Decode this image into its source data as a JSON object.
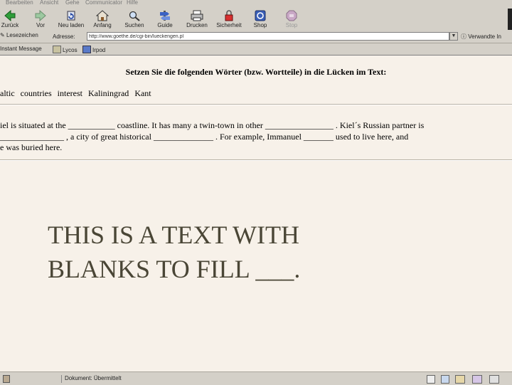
{
  "menu": [
    "Bearbeiten",
    "Ansicht",
    "Gehe",
    "Communicator",
    "Hilfe"
  ],
  "toolbar": [
    {
      "label": "Zurück",
      "icon": "back-arrow-icon",
      "enabled": true
    },
    {
      "label": "Vor",
      "icon": "forward-arrow-icon",
      "enabled": true
    },
    {
      "label": "Neu laden",
      "icon": "reload-icon",
      "enabled": true
    },
    {
      "label": "Anfang",
      "icon": "home-icon",
      "enabled": true
    },
    {
      "label": "Suchen",
      "icon": "search-icon",
      "enabled": true
    },
    {
      "label": "Guide",
      "icon": "guide-icon",
      "enabled": true
    },
    {
      "label": "Drucken",
      "icon": "print-icon",
      "enabled": true
    },
    {
      "label": "Sicherheit",
      "icon": "lock-icon",
      "enabled": true
    },
    {
      "label": "Shop",
      "icon": "shop-icon",
      "enabled": true
    },
    {
      "label": "Stop",
      "icon": "stop-icon",
      "enabled": false
    }
  ],
  "address_bar": {
    "bookmarks_label": "Lesezeichen",
    "address_label": "Adresse:",
    "url": "http://www.goethe.de/cgi-bin/lueckengen.pl",
    "related_label": "Verwandte In"
  },
  "personal_toolbar": [
    "Instant Message",
    "Lycos",
    "Irpod"
  ],
  "content": {
    "instruction": "Setzen Sie die folgenden Wörter (bzw. Wortteile) in die Lücken im Text:",
    "word_bank": [
      "altic",
      "countries",
      "interest",
      "Kaliningrad",
      "Kant"
    ],
    "exercise_lines": [
      "iel is situated at the ___________ coastline. It has many a twin-town in other ________________ . Kiel´s Russian partner is",
      "_______________ , a city of great historical ______________ . For example, Immanuel _______ used to live here, and",
      "e was buried here."
    ],
    "overlay_lines": [
      "THIS IS A TEXT WITH",
      "BLANKS TO FILL ___."
    ]
  },
  "status_bar": {
    "text": "Dokument: Übermittelt"
  }
}
